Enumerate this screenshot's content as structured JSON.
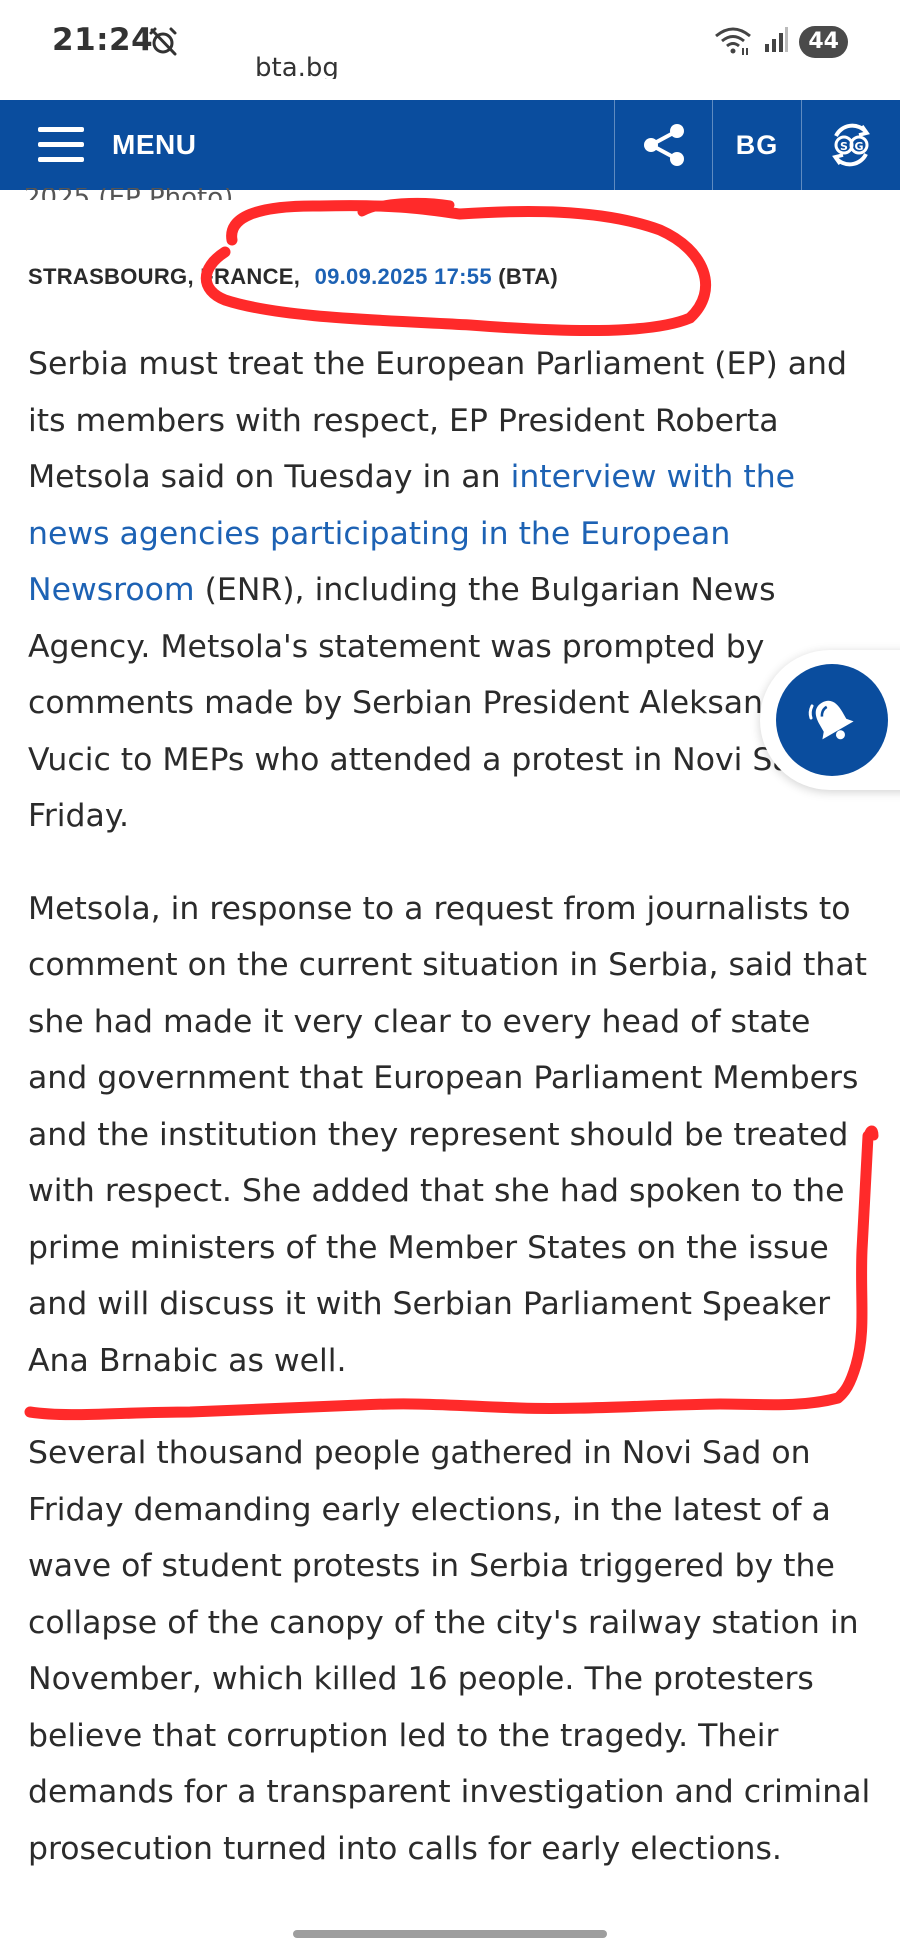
{
  "status_bar": {
    "time": "21:24",
    "battery": "44",
    "icons": [
      "alarm-off-icon",
      "wifi-icon",
      "signal-icon",
      "battery-icon"
    ]
  },
  "partial_top_text": "bta.bg",
  "partial_caption_line": "2025 (EP Photo)",
  "navbar": {
    "background": "#0a4d9e",
    "menu_label": "MENU",
    "language_label": "BG",
    "icons": [
      "hamburger-icon",
      "share-icon",
      "sign-language-icon"
    ]
  },
  "dateline": {
    "location": "STRASBOURG, FRANCE,",
    "datetime": "09.09.2025 17:55",
    "agency": "(BTA)",
    "link_color": "#1d62b4"
  },
  "article": {
    "p1": {
      "t1": "Serbia must treat the European Parliament (EP) and its members with respect, EP President Roberta Metsola said on Tuesday in an ",
      "link": "interview with the news agencies participating in the European Newsroom",
      "t2": " (ENR), including the Bulgarian News Agency. Metsola's statement was prompted by comments made by Serbian President Aleksandar Vucic to MEPs who attended a protest in Novi Sad on Friday."
    },
    "p2": "Metsola, in response to a request from journalists to comment on the current situation in Serbia, said that she had made it very clear to every head of state and government that European Parliament Members and the institution they represent should be treated with respect. She added that she had spoken to the prime ministers of the Member States on the issue and will discuss it with Serbian Parliament Speaker Ana Brnabic as well.",
    "p3": "Several thousand people gathered in Novi Sad on Friday demanding early elections, in the latest of a wave of student protests in Serbia triggered by the collapse of the canopy of the city's railway station in November, which killed 16 people. The protesters believe that corruption led to the tragedy. Their demands for a transparent investigation and criminal prosecution turned into calls for early elections."
  },
  "floating_button": {
    "icon": "bell-icon",
    "color": "#0a4d9e"
  },
  "annotation_color": "#ff2a2a"
}
